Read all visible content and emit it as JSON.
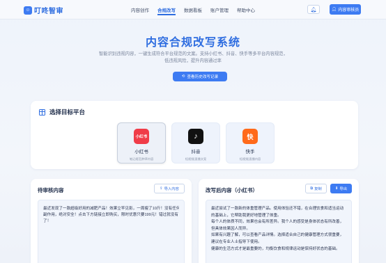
{
  "header": {
    "brand": "叮咚智审",
    "nav": [
      "内容创作",
      "合规改写",
      "数据看板",
      "账户管理",
      "帮助中心"
    ],
    "active_nav_index": 1,
    "user_label": "内容审核员",
    "accent": "#2e6de0"
  },
  "hero": {
    "title": "内容合规改写系统",
    "desc_lines": [
      "智能识别违规内容，一键生成符合平台规范的文案。支持小红书、抖音、快手等多平台内容规范，降",
      "低违规风险，提升内容通过率"
    ],
    "history_button": "查看历史改写记录"
  },
  "platform_section": {
    "title": "选择目标平台",
    "platforms": [
      {
        "logo_text": "小红书",
        "name": "小红书",
        "sub": "笔记规范|种草内容",
        "selected": true,
        "icon": "xiaohongshu-logo",
        "color": "#f03c48"
      },
      {
        "logo_text": "♪",
        "name": "抖音",
        "sub": "短视频|直播文案",
        "selected": false,
        "icon": "douyin-logo",
        "color": "#111111"
      },
      {
        "logo_text": "快",
        "name": "快手",
        "sub": "短视频|直播内容",
        "selected": false,
        "icon": "kuaishou-logo",
        "color": "#ff6a1a"
      }
    ]
  },
  "left_panel": {
    "title": "待审核内容",
    "import_button": "导入内容",
    "lines": [
      "最近发现了一款超级好用的减肥产品！效果立竿见影，一周瘦了10斤！没有任何",
      "副作用，绝对安全！点击下方链接立即购买，限时优惠只要199元！错过就没有",
      "了！"
    ]
  },
  "right_panel": {
    "title": "改写后内容（小红书）",
    "copy_button": "复制",
    "export_button": "导出",
    "lines": [
      "最近尝试了一款新的体重管理产品。使用体验还不错，在合理饮食和适当运动",
      "的基础上，它帮助我更好地管理了体重。",
      "每个人的体质不同，效果也会有所差异。我个人的感受是身体状态有所改善，",
      "但具体效果因人而异。",
      "如果有兴趣了解，可以查看产品详情。选择适合自己的健康管理方式很重要，",
      "建议在专业人士指导下使用。",
      "健康的生活方式才是最重要的，均衡饮食和规律运动是保持好状态的基础。"
    ]
  }
}
